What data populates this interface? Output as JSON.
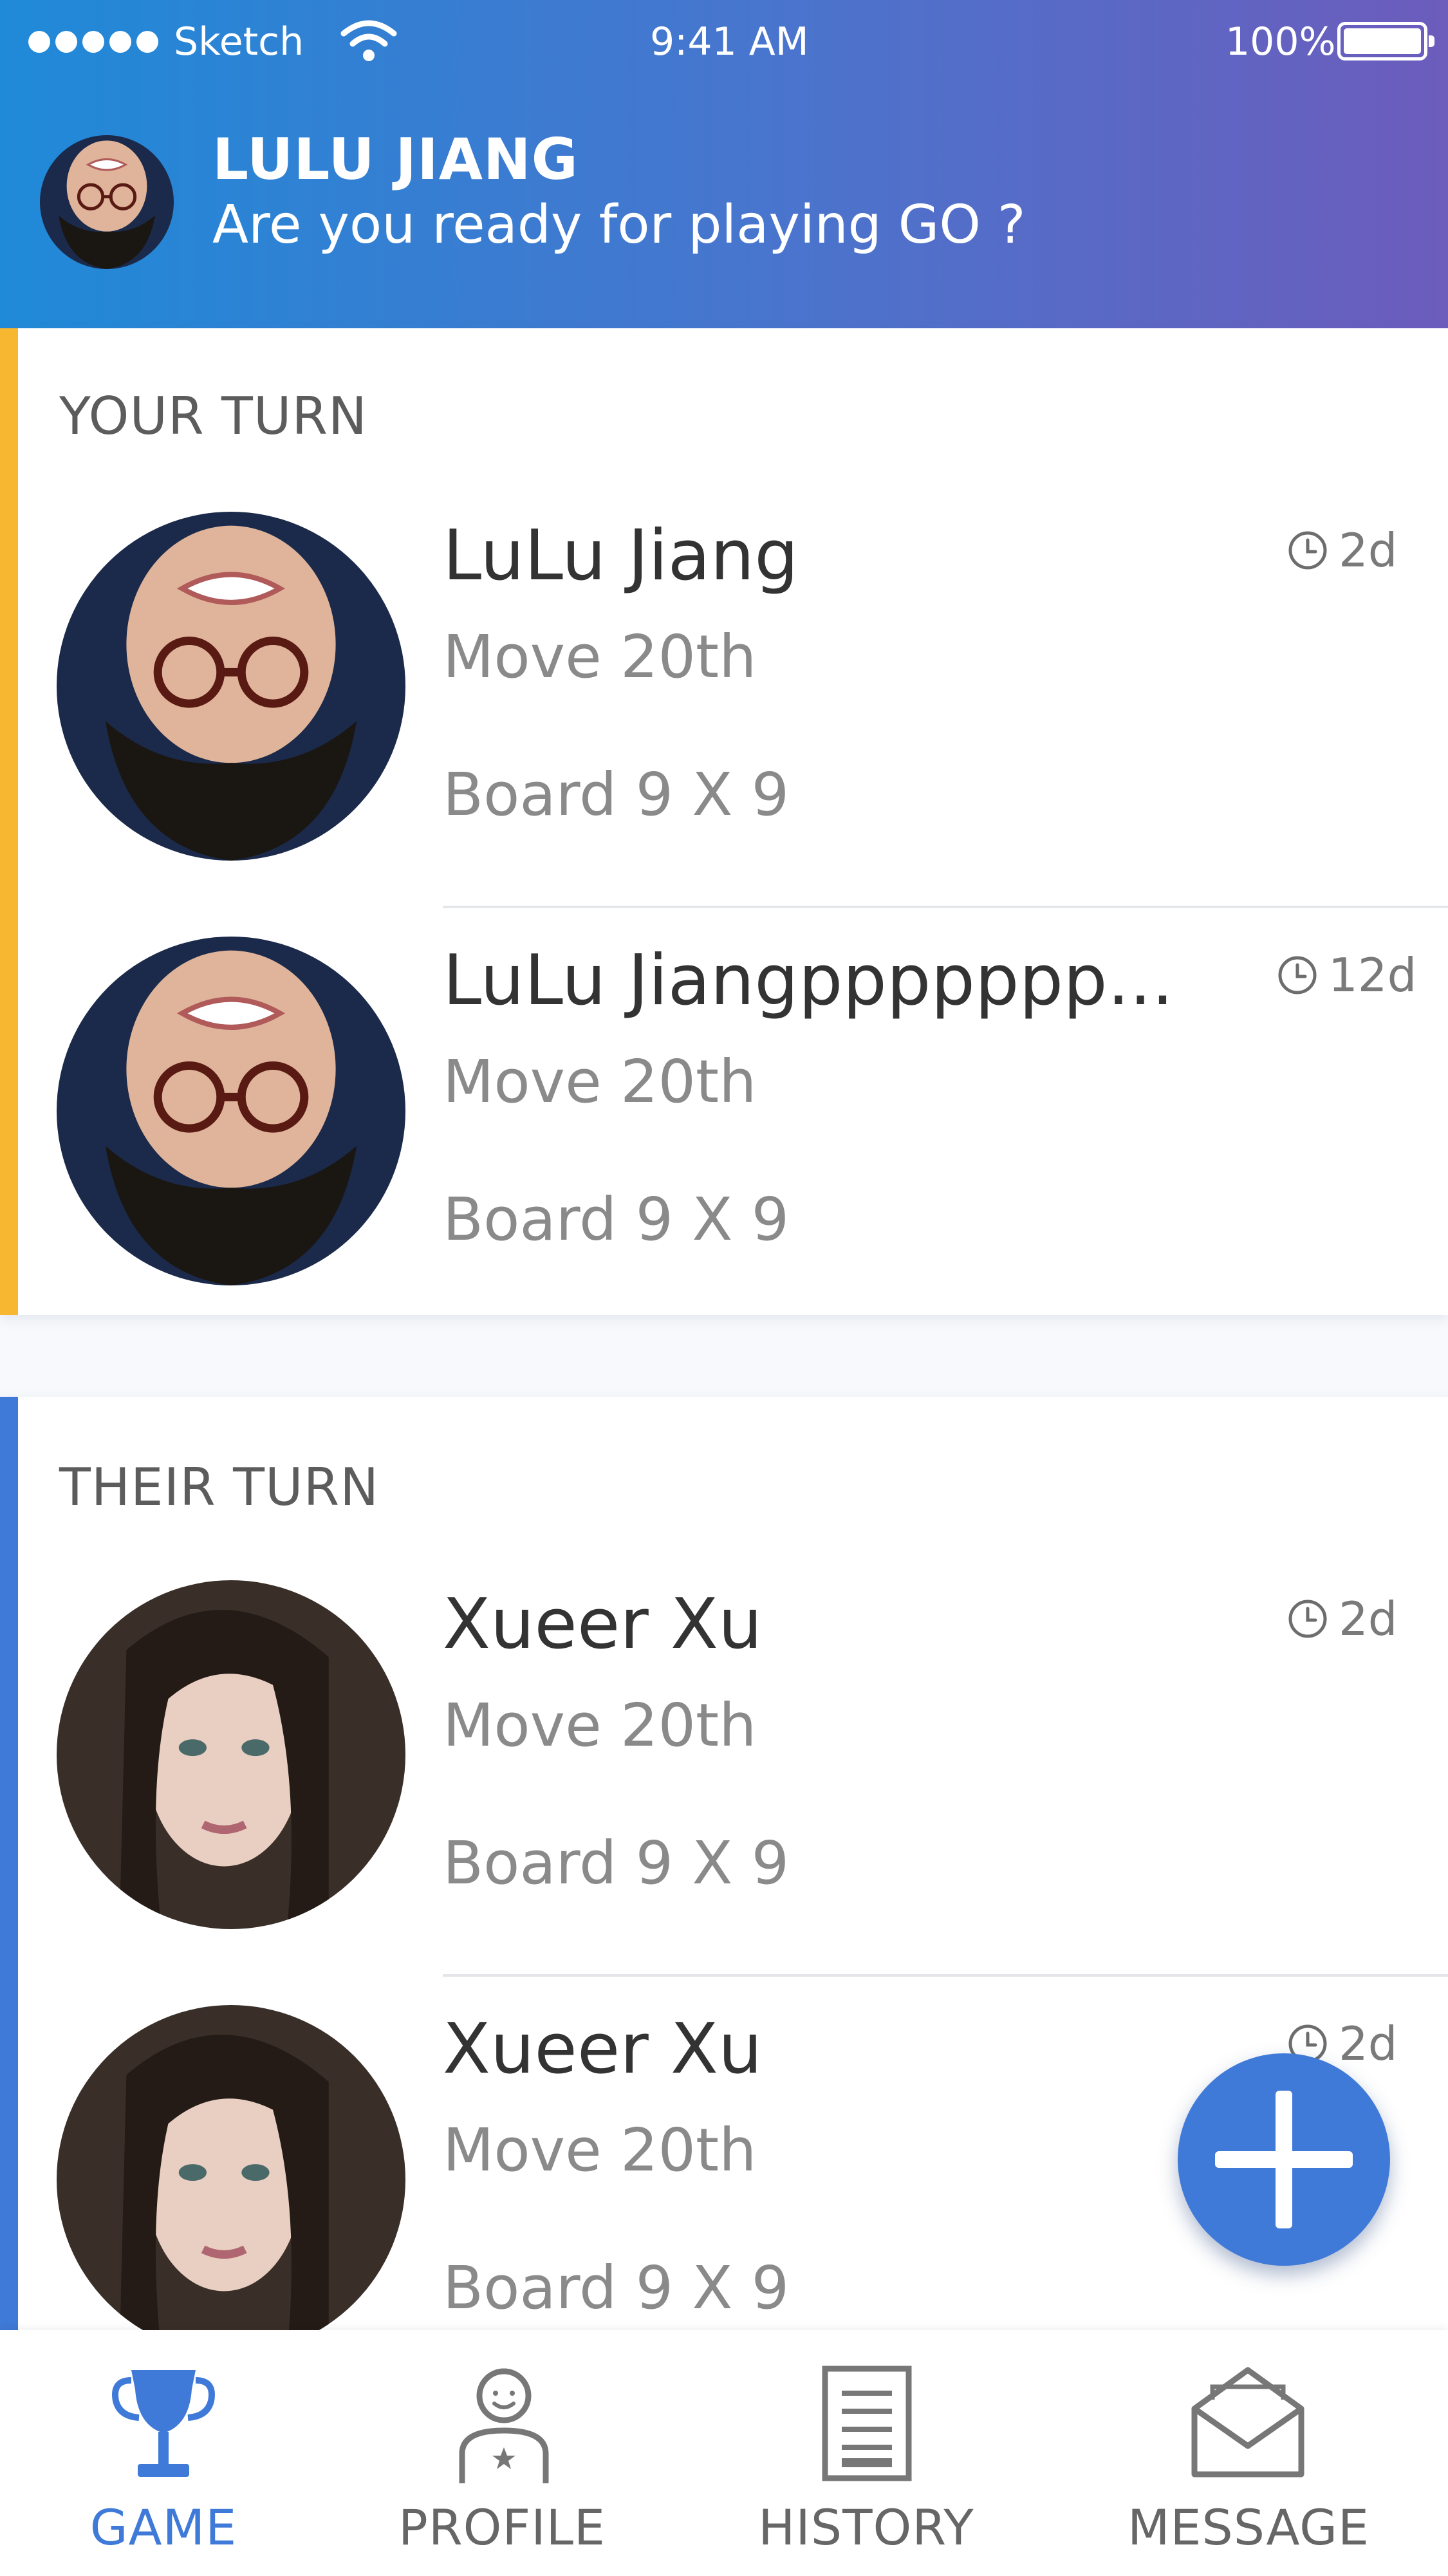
{
  "status_bar": {
    "carrier": "Sketch",
    "time": "9:41 AM",
    "battery": "100%",
    "icons": [
      "signal-dots-icon",
      "wifi-icon",
      "battery-icon"
    ]
  },
  "header": {
    "user_name": "LULU JIANG",
    "tagline": "Are you ready for playing GO ?"
  },
  "your_turn": {
    "title": "YOUR TURN",
    "games": [
      {
        "name": "LuLu Jiang",
        "move": "Move 20th",
        "board": "Board 9 X 9",
        "time": "2d"
      },
      {
        "name": "LuLu Jiangppppppp...",
        "move": "Move 20th",
        "board": "Board 9 X 9",
        "time": "12d"
      }
    ]
  },
  "their_turn": {
    "title": "THEIR TURN",
    "games": [
      {
        "name": "Xueer Xu",
        "move": "Move 20th",
        "board": "Board 9 X 9",
        "time": "2d"
      },
      {
        "name": "Xueer Xu",
        "move": "Move 20th",
        "board": "Board 9 X 9",
        "time": "2d"
      }
    ]
  },
  "tabs": [
    {
      "label": "GAME",
      "icon": "trophy-icon",
      "active": true
    },
    {
      "label": "PROFILE",
      "icon": "profile-icon",
      "active": false
    },
    {
      "label": "HISTORY",
      "icon": "document-icon",
      "active": false
    },
    {
      "label": "MESSAGE",
      "icon": "envelope-icon",
      "active": false
    }
  ],
  "fab": {
    "icon": "plus-icon"
  },
  "colors": {
    "accent_blue": "#3f7ad8",
    "accent_yellow": "#f8b731",
    "header_gradient": [
      "#1f8ad8",
      "#6c5cbc"
    ]
  }
}
